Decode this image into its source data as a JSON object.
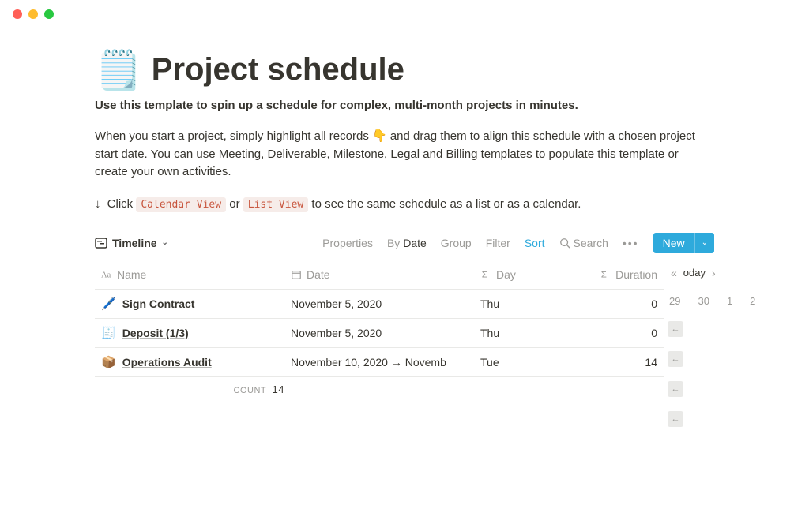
{
  "page": {
    "icon": "🗒️",
    "title": "Project schedule",
    "subtitle": "Use this template to spin up a schedule for complex, multi-month projects in minutes.",
    "description": "When you start a project, simply highlight all records 👇 and drag them to align this schedule with a chosen project start date. You can use Meeting, Deliverable, Milestone, Legal and Billing templates to populate this template or create your own activities.",
    "hint_prefix": "↓",
    "hint_click": "Click",
    "hint_code1": "Calendar View",
    "hint_or": "or",
    "hint_code2": "List View",
    "hint_suffix": "to see the same schedule as a list or as a calendar."
  },
  "toolbar": {
    "view_name": "Timeline",
    "properties": "Properties",
    "by_prefix": "By",
    "by_value": "Date",
    "group": "Group",
    "filter": "Filter",
    "sort": "Sort",
    "search": "Search",
    "new_label": "New"
  },
  "table": {
    "columns": {
      "name": "Name",
      "date": "Date",
      "day": "Day",
      "duration": "Duration"
    },
    "rows": [
      {
        "icon": "🖊️",
        "name": "Sign Contract",
        "date": "November 5, 2020",
        "day": "Thu",
        "duration": "0"
      },
      {
        "icon": "🧾",
        "name": "Deposit (1/3)",
        "date": "November 5, 2020",
        "day": "Thu",
        "duration": "0"
      },
      {
        "icon": "📦",
        "name": "Operations Audit",
        "date": "November 10, 2020 → Novemb",
        "day": "Tue",
        "duration": "14"
      }
    ],
    "count_label": "COUNT",
    "count_value": "14"
  },
  "timeline": {
    "today": "oday",
    "dates": [
      "29",
      "30",
      "1",
      "2"
    ]
  }
}
